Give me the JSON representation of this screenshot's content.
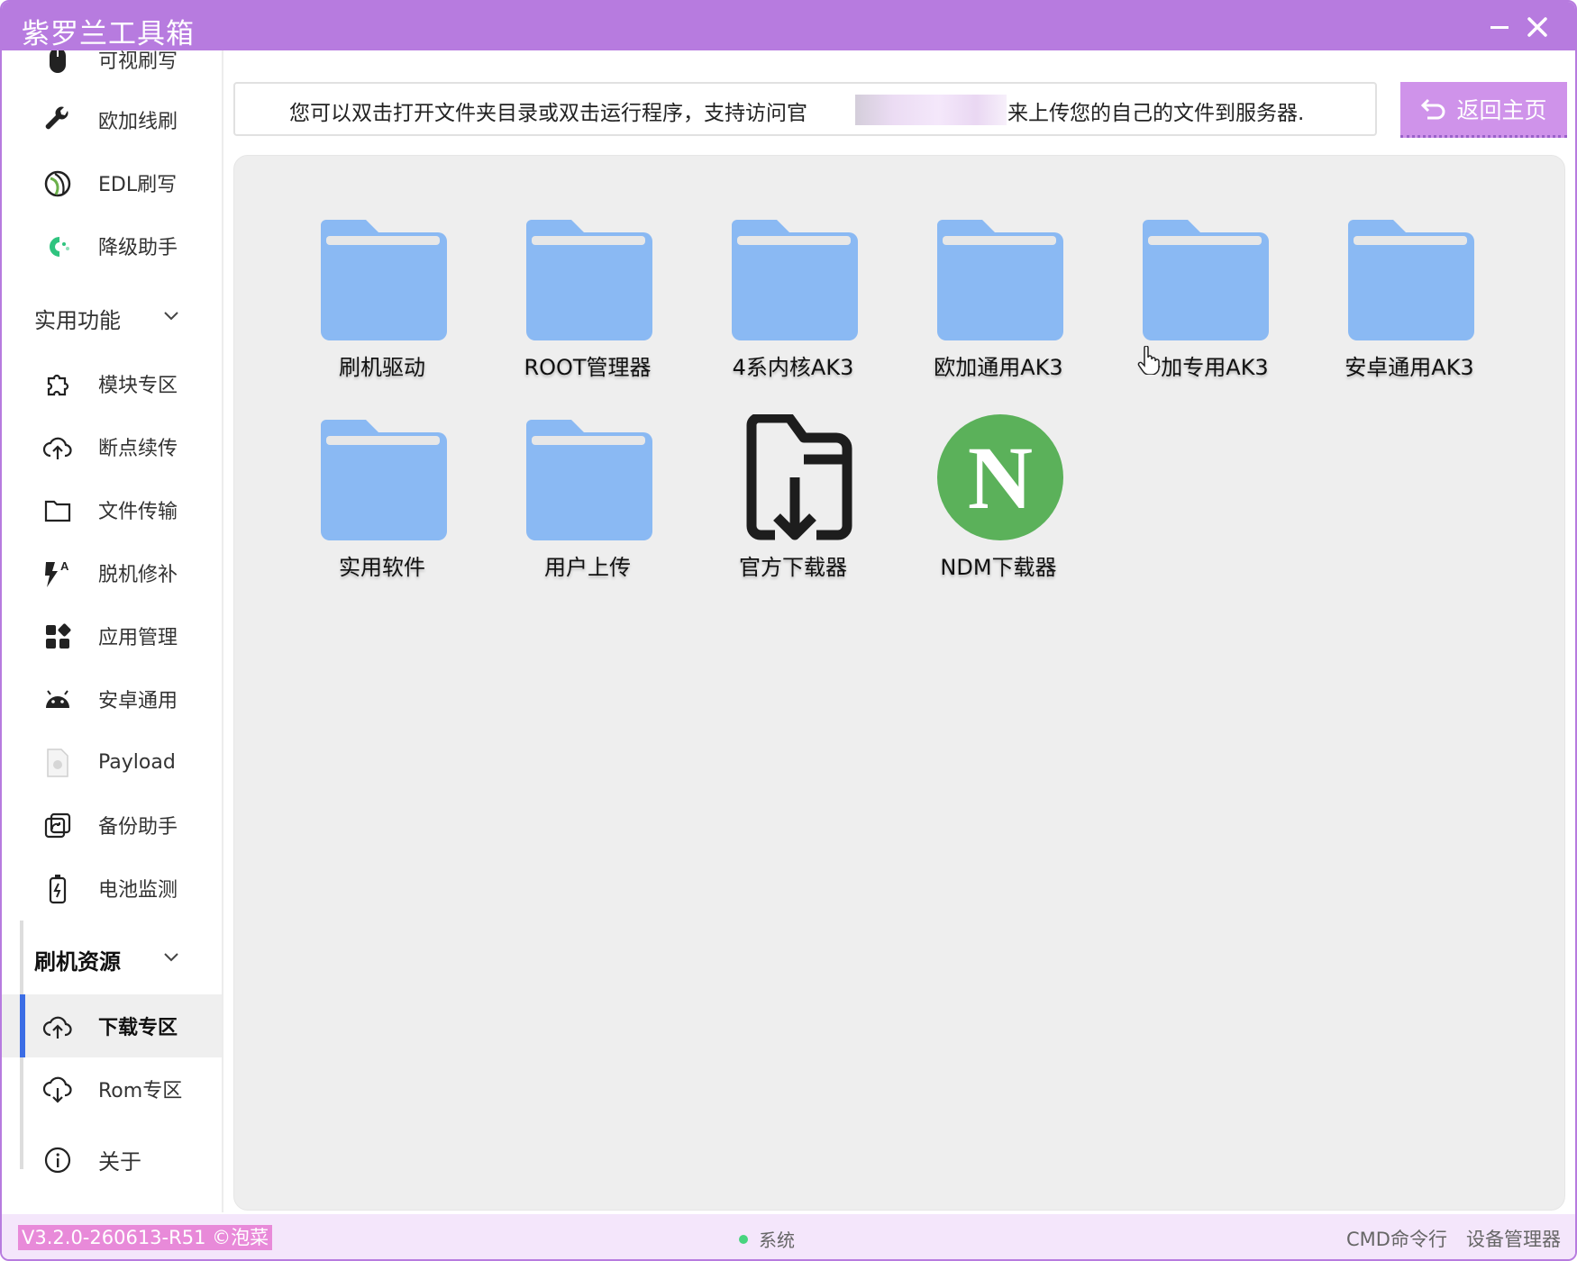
{
  "window": {
    "title": "紫罗兰工具箱",
    "accent_color": "#b77bdf"
  },
  "sidebar": {
    "items_top": [
      {
        "label": "可视刷写",
        "icon": "mouse-icon"
      },
      {
        "label": "欧加线刷",
        "icon": "wrench-icon"
      },
      {
        "label": "EDL刷写",
        "icon": "edl-icon"
      },
      {
        "label": "降级助手",
        "icon": "downgrade-icon"
      }
    ],
    "group_utility": {
      "label": "实用功能",
      "items": [
        {
          "label": "模块专区",
          "icon": "puzzle-icon"
        },
        {
          "label": "断点续传",
          "icon": "cloud-upload-icon"
        },
        {
          "label": "文件传输",
          "icon": "folder-icon"
        },
        {
          "label": "脱机修补",
          "icon": "flash-icon"
        },
        {
          "label": "应用管理",
          "icon": "apps-icon"
        },
        {
          "label": "安卓通用",
          "icon": "android-icon"
        },
        {
          "label": "Payload",
          "icon": "file-icon"
        },
        {
          "label": "备份助手",
          "icon": "backup-icon"
        },
        {
          "label": "电池监测",
          "icon": "battery-icon"
        }
      ]
    },
    "group_resources": {
      "label": "刷机资源",
      "items": [
        {
          "label": "下载专区",
          "icon": "cloud-upload-icon",
          "active": true
        },
        {
          "label": "Rom专区",
          "icon": "cloud-download-icon"
        }
      ]
    },
    "about": {
      "label": "关于",
      "icon": "info-icon"
    }
  },
  "notice": {
    "text_before": "您可以双击打开文件夹目录或双击运行程序，支持访问官",
    "text_after": "来上传您的自己的文件到服务器."
  },
  "home_button": {
    "label": "返回主页"
  },
  "tiles": [
    {
      "label": "刷机驱动",
      "type": "folder"
    },
    {
      "label": "ROOT管理器",
      "type": "folder"
    },
    {
      "label": "4系内核AK3",
      "type": "folder"
    },
    {
      "label": "欧加通用AK3",
      "type": "folder"
    },
    {
      "label": "一加专用AK3",
      "type": "folder"
    },
    {
      "label": "安卓通用AK3",
      "type": "folder"
    },
    {
      "label": "实用软件",
      "type": "folder"
    },
    {
      "label": "用户上传",
      "type": "folder"
    },
    {
      "label": "官方下载器",
      "type": "folder-download"
    },
    {
      "label": "NDM下载器",
      "type": "ndm"
    }
  ],
  "ndm_logo_letter": "N",
  "colors": {
    "folder": "#8ab9f3",
    "folder_tab": "#e7e7e7",
    "ndm_green": "#5bb15a",
    "active_indicator": "#3b6de5",
    "version_badge": "#e88ad9"
  },
  "statusbar": {
    "version": "V3.2.0-260613-R51 ©泡菜",
    "system": "系统",
    "cmd": "CMD命令行",
    "device_manager": "设备管理器"
  }
}
